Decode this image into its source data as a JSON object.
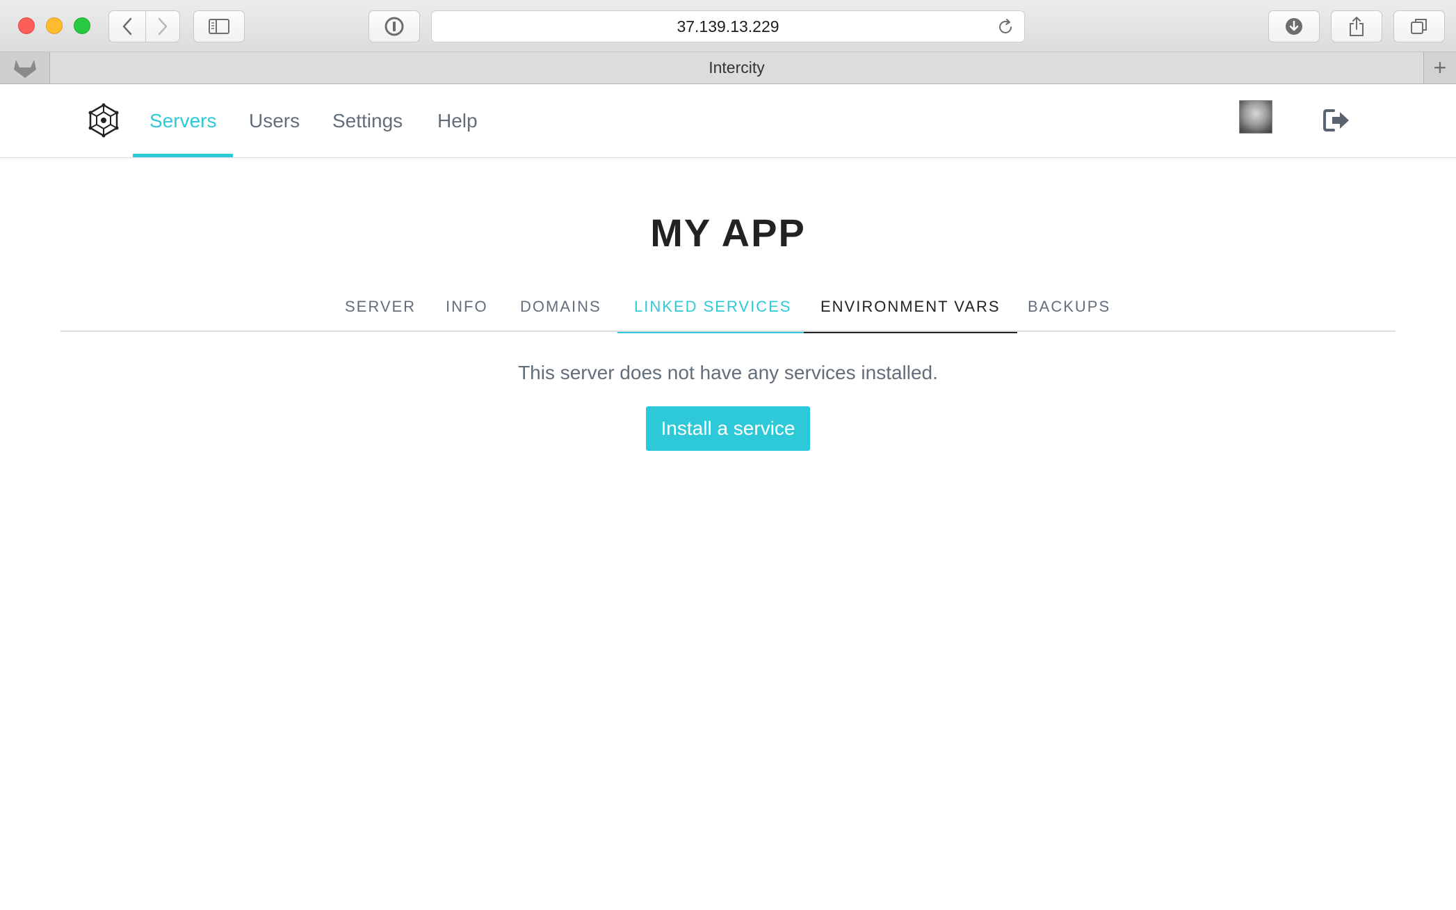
{
  "browser": {
    "url": "37.139.13.229",
    "tab_title": "Intercity",
    "new_tab_label": "+"
  },
  "nav": {
    "items": [
      {
        "label": "Servers",
        "active": true
      },
      {
        "label": "Users",
        "active": false
      },
      {
        "label": "Settings",
        "active": false
      },
      {
        "label": "Help",
        "active": false
      }
    ]
  },
  "page": {
    "title": "MY APP",
    "tabs": [
      {
        "label": "SERVER",
        "state": "normal"
      },
      {
        "label": "INFO",
        "state": "normal"
      },
      {
        "label": "DOMAINS",
        "state": "normal"
      },
      {
        "label": "LINKED SERVICES",
        "state": "active"
      },
      {
        "label": "ENVIRONMENT VARS",
        "state": "hover"
      },
      {
        "label": "BACKUPS",
        "state": "normal"
      }
    ],
    "empty_message": "This server does not have any services installed.",
    "install_button": "Install a service"
  },
  "colors": {
    "accent": "#2ec9d8",
    "text_muted": "#636e7b",
    "text_dark": "#222222"
  },
  "icons": {
    "logo": "hexagon-network-icon",
    "logout": "sign-out-icon",
    "reload": "reload-icon",
    "download": "download-icon",
    "share": "share-icon",
    "tabs": "tabs-overview-icon",
    "password": "password-manager-icon",
    "sidebar": "sidebar-icon",
    "pinned_tab": "gitlab-fox-icon"
  }
}
